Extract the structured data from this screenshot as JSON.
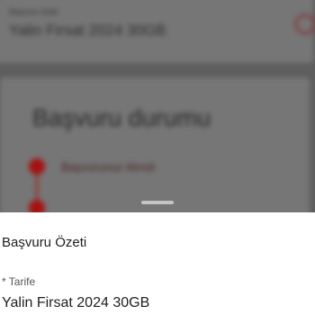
{
  "background": {
    "tariff_label": "Başvuru özeti",
    "tariff_value": "Yalin Firsat 2024 30GB",
    "status_heading": "Başvuru durumu",
    "step_1": "Başvurunuz Alındı"
  },
  "sheet": {
    "title": "Başvuru Özeti",
    "field_label": "* Tarife",
    "field_value": "Yalin Firsat 2024 30GB"
  },
  "colors": {
    "accent": "#a61111",
    "overlay": "#5e5e5e",
    "sheet_bg": "#ffffff"
  }
}
